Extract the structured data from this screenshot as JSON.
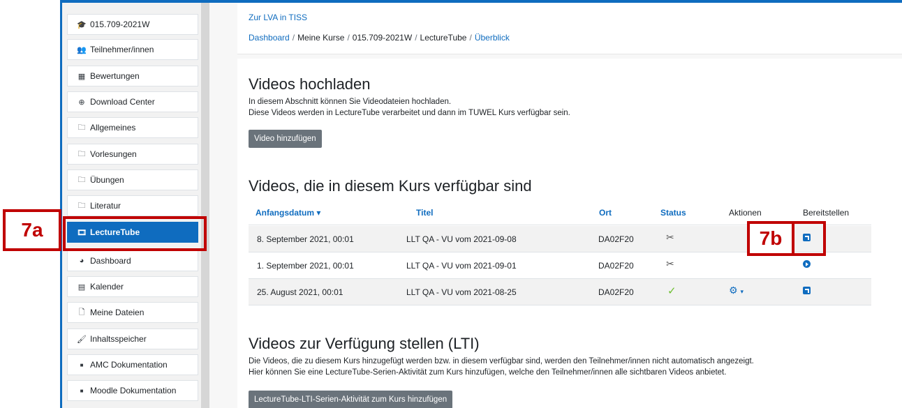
{
  "sidebar": {
    "items": [
      {
        "icon": "graduation-cap-icon",
        "label": "015.709-2021W"
      },
      {
        "icon": "users-icon",
        "label": "Teilnehmer/innen"
      },
      {
        "icon": "table-icon",
        "label": "Bewertungen"
      },
      {
        "icon": "download-icon",
        "label": "Download Center"
      },
      {
        "icon": "folder-icon",
        "label": "Allgemeines"
      },
      {
        "icon": "folder-icon",
        "label": "Vorlesungen"
      },
      {
        "icon": "folder-icon",
        "label": "Übungen"
      },
      {
        "icon": "folder-icon",
        "label": "Literatur"
      },
      {
        "icon": "film-icon",
        "label": "LectureTube"
      },
      {
        "icon": "dashboard-icon",
        "label": "Dashboard"
      },
      {
        "icon": "calendar-icon",
        "label": "Kalender"
      },
      {
        "icon": "file-icon",
        "label": "Meine Dateien"
      },
      {
        "icon": "brush-icon",
        "label": "Inhaltsspeicher"
      },
      {
        "icon": "square-icon",
        "label": "AMC Dokumentation"
      },
      {
        "icon": "square-icon",
        "label": "Moodle Dokumentation"
      }
    ]
  },
  "header": {
    "lva_link": "Zur LVA in TISS",
    "breadcrumb": {
      "b0": "Dashboard",
      "b1": "Meine Kurse",
      "b2": "015.709-2021W",
      "b3": "LectureTube",
      "b4": "Überblick",
      "sep": "/"
    }
  },
  "upload": {
    "title": "Videos hochladen",
    "line1": "In diesem Abschnitt können Sie Videodateien hochladen.",
    "line2": "Diese Videos werden in LectureTube verarbeitet und dann im TUWEL Kurs verfügbar sein.",
    "button": "Video hinzufügen"
  },
  "videos": {
    "title": "Videos, die in diesem Kurs verfügbar sind",
    "columns": {
      "date": "Anfangsdatum",
      "sort_icon": "▾",
      "title": "Titel",
      "location": "Ort",
      "status": "Status",
      "actions": "Aktionen",
      "share": "Bereitstellen"
    },
    "rows": [
      {
        "date": "8. September 2021, 00:01",
        "title": "LLT QA - VU vom 2021-09-08",
        "location": "DA02F20",
        "status_icon": "scissors-icon",
        "share_icon": "share-icon"
      },
      {
        "date": "1. September 2021, 00:01",
        "title": "LLT QA - VU vom 2021-09-01",
        "location": "DA02F20",
        "status_icon": "scissors-icon",
        "share_icon": "play-icon"
      },
      {
        "date": "25. August 2021, 00:01",
        "title": "LLT QA - VU vom 2021-08-25",
        "location": "DA02F20",
        "status_icon": "check-icon",
        "share_icon": "share-icon"
      }
    ]
  },
  "lti": {
    "title": "Videos zur Verfügung stellen (LTI)",
    "line1": "Die Videos, die zu diesem Kurs hinzugefügt werden bzw. in diesem verfügbar sind, werden den Teilnehmer/innen nicht automatisch angezeigt.",
    "line2": "Hier können Sie eine LectureTube-Serien-Aktivität zum Kurs hinzufügen, welche den Teilnehmer/innen alle sichtbaren Videos anbietet.",
    "button": "LectureTube-LTI-Serien-Aktivität zum Kurs hinzufügen"
  },
  "annotations": {
    "a": "7a",
    "b": "7b",
    "color": "#c00000"
  },
  "colors": {
    "accent": "#0f6cbf",
    "annotation": "#c00000",
    "button": "#6a737b",
    "check": "#6cbf2f"
  }
}
